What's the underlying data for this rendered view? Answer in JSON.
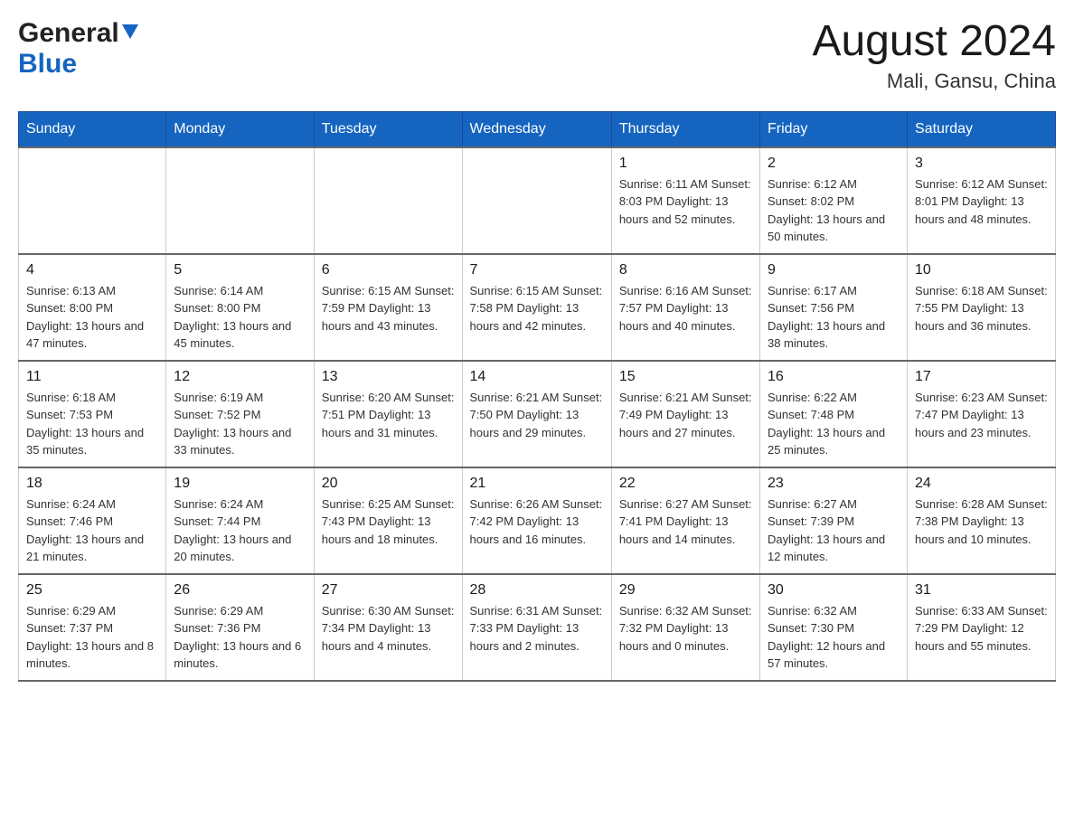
{
  "header": {
    "logo_general": "General",
    "logo_blue": "Blue",
    "month_year": "August 2024",
    "location": "Mali, Gansu, China"
  },
  "days_of_week": [
    "Sunday",
    "Monday",
    "Tuesday",
    "Wednesday",
    "Thursday",
    "Friday",
    "Saturday"
  ],
  "weeks": [
    [
      {
        "day": "",
        "info": ""
      },
      {
        "day": "",
        "info": ""
      },
      {
        "day": "",
        "info": ""
      },
      {
        "day": "",
        "info": ""
      },
      {
        "day": "1",
        "info": "Sunrise: 6:11 AM\nSunset: 8:03 PM\nDaylight: 13 hours\nand 52 minutes."
      },
      {
        "day": "2",
        "info": "Sunrise: 6:12 AM\nSunset: 8:02 PM\nDaylight: 13 hours\nand 50 minutes."
      },
      {
        "day": "3",
        "info": "Sunrise: 6:12 AM\nSunset: 8:01 PM\nDaylight: 13 hours\nand 48 minutes."
      }
    ],
    [
      {
        "day": "4",
        "info": "Sunrise: 6:13 AM\nSunset: 8:00 PM\nDaylight: 13 hours\nand 47 minutes."
      },
      {
        "day": "5",
        "info": "Sunrise: 6:14 AM\nSunset: 8:00 PM\nDaylight: 13 hours\nand 45 minutes."
      },
      {
        "day": "6",
        "info": "Sunrise: 6:15 AM\nSunset: 7:59 PM\nDaylight: 13 hours\nand 43 minutes."
      },
      {
        "day": "7",
        "info": "Sunrise: 6:15 AM\nSunset: 7:58 PM\nDaylight: 13 hours\nand 42 minutes."
      },
      {
        "day": "8",
        "info": "Sunrise: 6:16 AM\nSunset: 7:57 PM\nDaylight: 13 hours\nand 40 minutes."
      },
      {
        "day": "9",
        "info": "Sunrise: 6:17 AM\nSunset: 7:56 PM\nDaylight: 13 hours\nand 38 minutes."
      },
      {
        "day": "10",
        "info": "Sunrise: 6:18 AM\nSunset: 7:55 PM\nDaylight: 13 hours\nand 36 minutes."
      }
    ],
    [
      {
        "day": "11",
        "info": "Sunrise: 6:18 AM\nSunset: 7:53 PM\nDaylight: 13 hours\nand 35 minutes."
      },
      {
        "day": "12",
        "info": "Sunrise: 6:19 AM\nSunset: 7:52 PM\nDaylight: 13 hours\nand 33 minutes."
      },
      {
        "day": "13",
        "info": "Sunrise: 6:20 AM\nSunset: 7:51 PM\nDaylight: 13 hours\nand 31 minutes."
      },
      {
        "day": "14",
        "info": "Sunrise: 6:21 AM\nSunset: 7:50 PM\nDaylight: 13 hours\nand 29 minutes."
      },
      {
        "day": "15",
        "info": "Sunrise: 6:21 AM\nSunset: 7:49 PM\nDaylight: 13 hours\nand 27 minutes."
      },
      {
        "day": "16",
        "info": "Sunrise: 6:22 AM\nSunset: 7:48 PM\nDaylight: 13 hours\nand 25 minutes."
      },
      {
        "day": "17",
        "info": "Sunrise: 6:23 AM\nSunset: 7:47 PM\nDaylight: 13 hours\nand 23 minutes."
      }
    ],
    [
      {
        "day": "18",
        "info": "Sunrise: 6:24 AM\nSunset: 7:46 PM\nDaylight: 13 hours\nand 21 minutes."
      },
      {
        "day": "19",
        "info": "Sunrise: 6:24 AM\nSunset: 7:44 PM\nDaylight: 13 hours\nand 20 minutes."
      },
      {
        "day": "20",
        "info": "Sunrise: 6:25 AM\nSunset: 7:43 PM\nDaylight: 13 hours\nand 18 minutes."
      },
      {
        "day": "21",
        "info": "Sunrise: 6:26 AM\nSunset: 7:42 PM\nDaylight: 13 hours\nand 16 minutes."
      },
      {
        "day": "22",
        "info": "Sunrise: 6:27 AM\nSunset: 7:41 PM\nDaylight: 13 hours\nand 14 minutes."
      },
      {
        "day": "23",
        "info": "Sunrise: 6:27 AM\nSunset: 7:39 PM\nDaylight: 13 hours\nand 12 minutes."
      },
      {
        "day": "24",
        "info": "Sunrise: 6:28 AM\nSunset: 7:38 PM\nDaylight: 13 hours\nand 10 minutes."
      }
    ],
    [
      {
        "day": "25",
        "info": "Sunrise: 6:29 AM\nSunset: 7:37 PM\nDaylight: 13 hours\nand 8 minutes."
      },
      {
        "day": "26",
        "info": "Sunrise: 6:29 AM\nSunset: 7:36 PM\nDaylight: 13 hours\nand 6 minutes."
      },
      {
        "day": "27",
        "info": "Sunrise: 6:30 AM\nSunset: 7:34 PM\nDaylight: 13 hours\nand 4 minutes."
      },
      {
        "day": "28",
        "info": "Sunrise: 6:31 AM\nSunset: 7:33 PM\nDaylight: 13 hours\nand 2 minutes."
      },
      {
        "day": "29",
        "info": "Sunrise: 6:32 AM\nSunset: 7:32 PM\nDaylight: 13 hours\nand 0 minutes."
      },
      {
        "day": "30",
        "info": "Sunrise: 6:32 AM\nSunset: 7:30 PM\nDaylight: 12 hours\nand 57 minutes."
      },
      {
        "day": "31",
        "info": "Sunrise: 6:33 AM\nSunset: 7:29 PM\nDaylight: 12 hours\nand 55 minutes."
      }
    ]
  ]
}
